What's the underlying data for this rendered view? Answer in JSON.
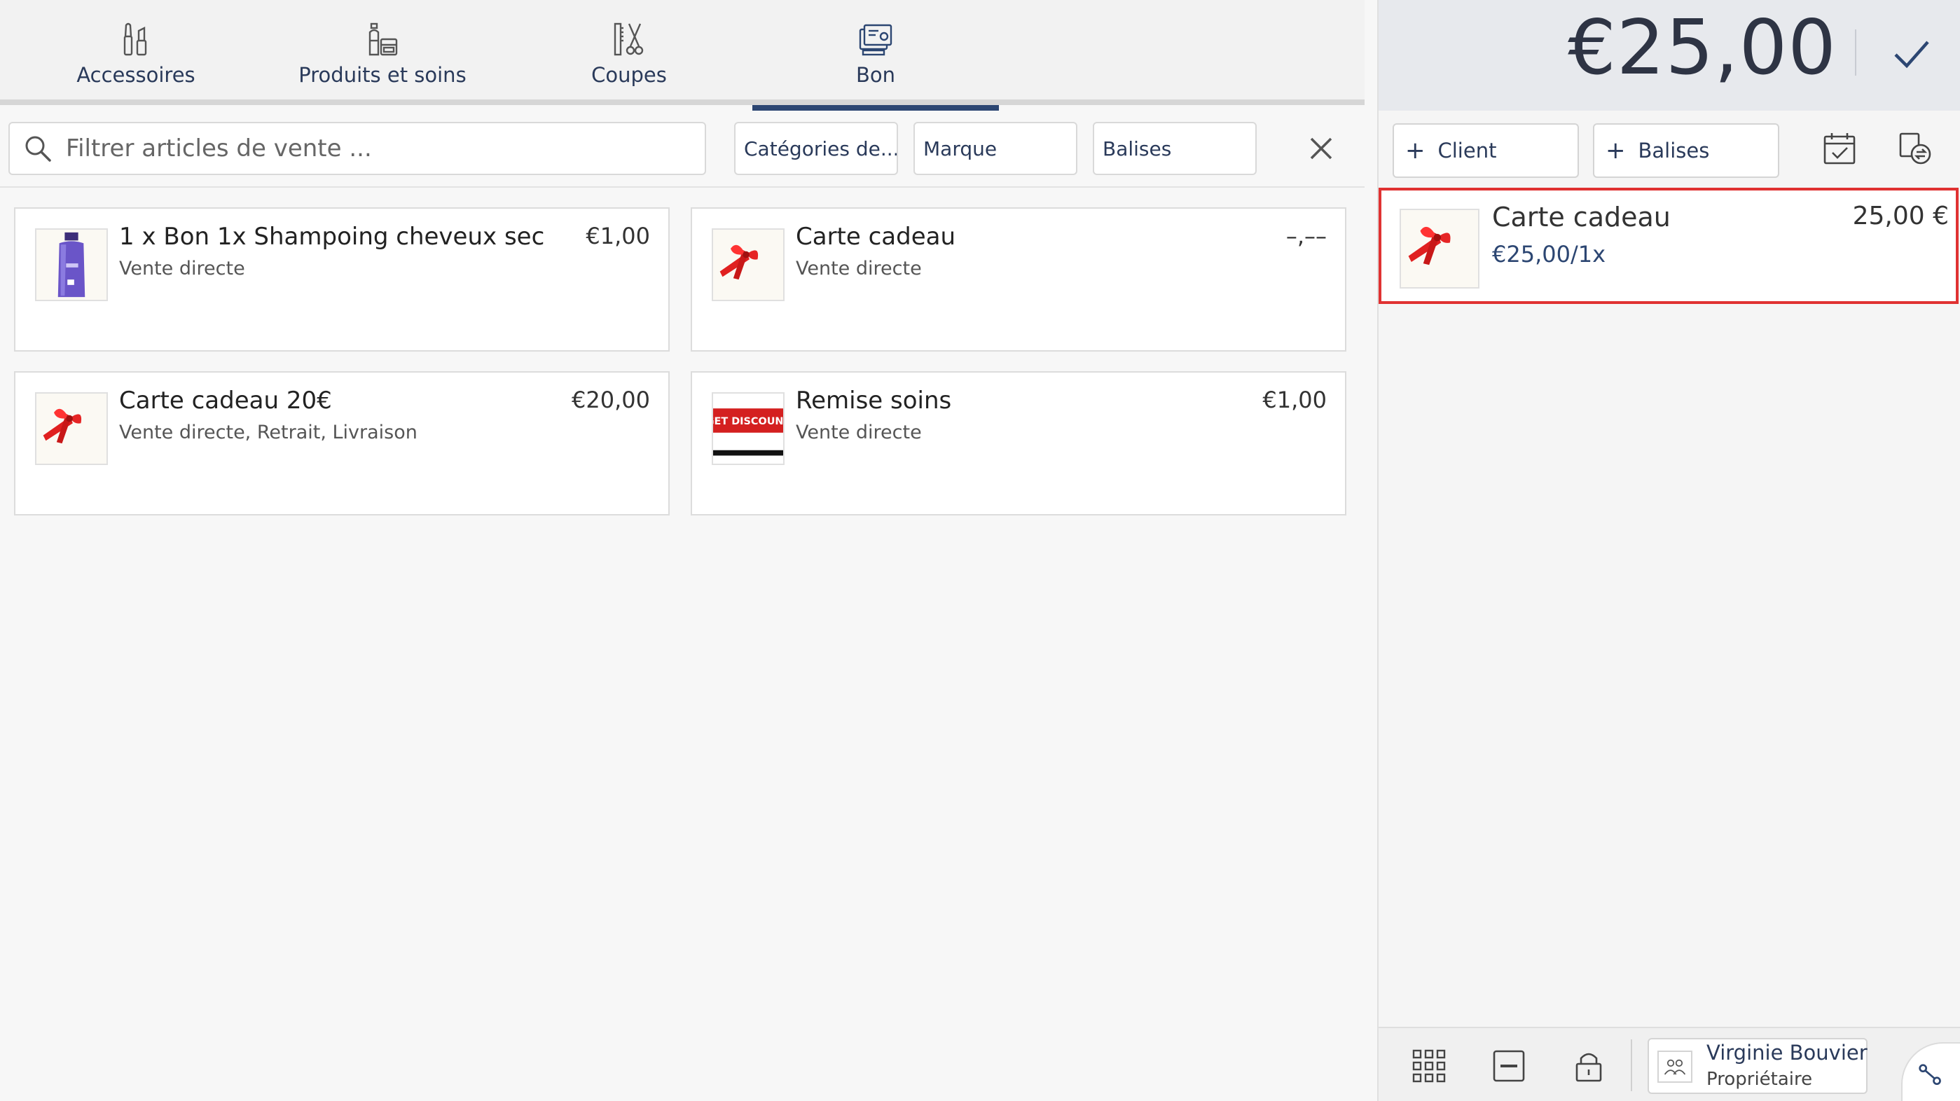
{
  "tabs": [
    {
      "label": "Accessoires",
      "icon": "brush-lipstick-icon"
    },
    {
      "label": "Produits et soins",
      "icon": "bottles-icon"
    },
    {
      "label": "Coupes",
      "icon": "scissors-comb-icon"
    },
    {
      "label": "Bon",
      "icon": "voucher-icon",
      "active": true
    }
  ],
  "filters": {
    "search_placeholder": "Filtrer articles de vente ...",
    "category_label": "Catégories de...",
    "brand_label": "Marque",
    "tags_label": "Balises"
  },
  "products": [
    {
      "name": "1 x Bon 1x Shampoing cheveux sec",
      "channels": "Vente directe",
      "price": "€1,00",
      "thumb": "shampoo-bottle"
    },
    {
      "name": "Carte cadeau",
      "channels": "Vente directe",
      "price": "–,––",
      "thumb": "gift-ribbon"
    },
    {
      "name": "Carte cadeau 20€",
      "channels": "Vente directe, Retrait, Livraison",
      "price": "€20,00",
      "thumb": "gift-ribbon"
    },
    {
      "name": "Remise soins",
      "channels": "Vente directe",
      "price": "€1,00",
      "thumb": "discount-label",
      "thumb_text": "GET DISCOUNT"
    }
  ],
  "cart": {
    "total": "€25,00",
    "client_label": "Client",
    "tags_label": "Balises",
    "items": [
      {
        "name": "Carte cadeau",
        "unit": "€25,00/1x",
        "price": "25,00 €"
      }
    ]
  },
  "user": {
    "name": "Virginie Bouvier",
    "role": "Propriétaire"
  },
  "colors": {
    "accent": "#2c4672",
    "highlight_border": "#e03232",
    "header_bg": "#e7e9ed"
  }
}
